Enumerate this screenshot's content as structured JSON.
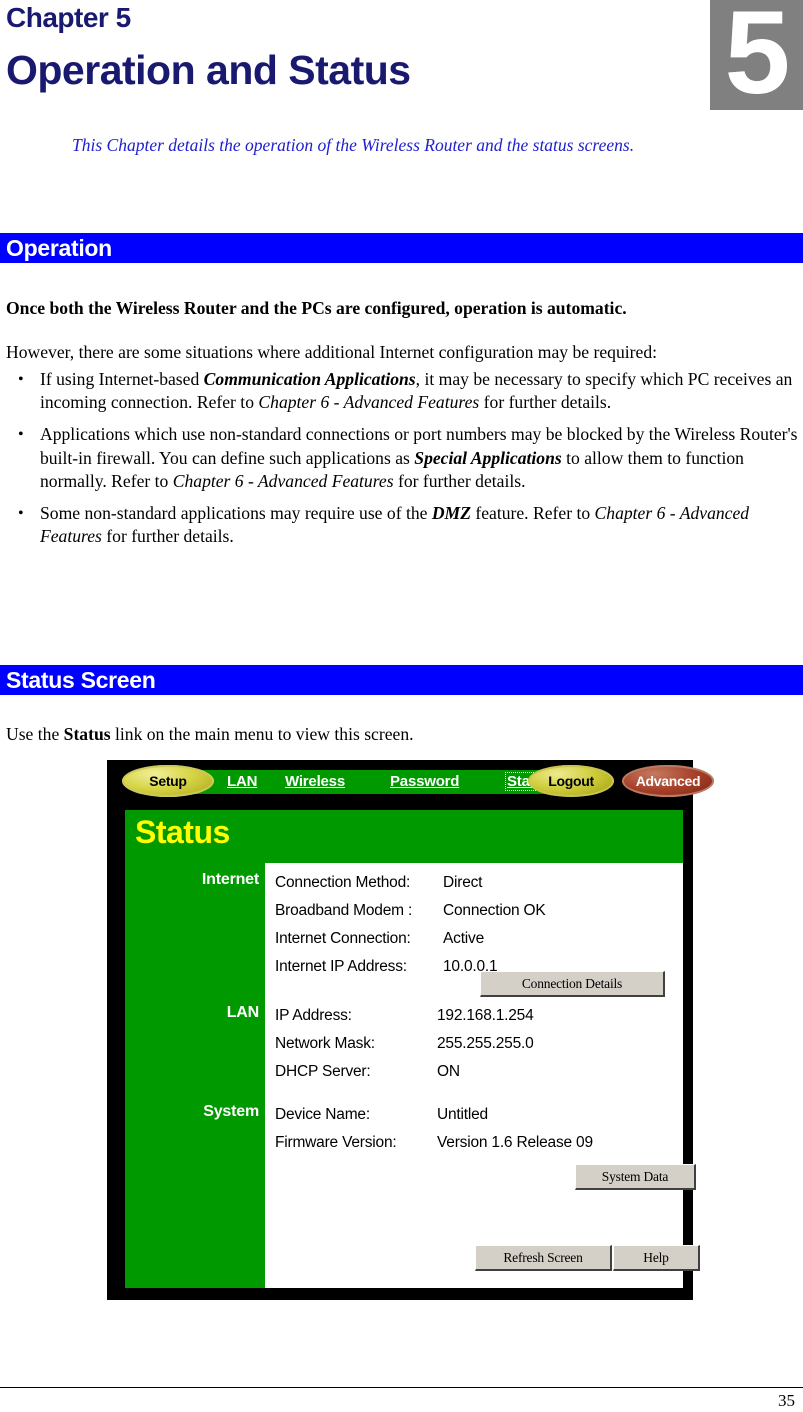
{
  "chapter": {
    "label": "Chapter 5",
    "number_glyph": "5",
    "title": "Operation and Status",
    "intro": "This Chapter details the operation of the Wireless Router and the status screens."
  },
  "sections": {
    "operation": {
      "heading": "Operation",
      "lead_bold": "Once both the Wireless Router and the PCs are configured, operation is automatic.",
      "lead_normal": "However, there are some situations where additional Internet configuration may be required:",
      "bullets": [
        {
          "marker": "•",
          "parts": [
            {
              "text": "If using Internet-based ",
              "style": "normal"
            },
            {
              "text": "Communication Applications",
              "style": "bold-italic"
            },
            {
              "text": ", it may be necessary to specify which PC receives an incoming connection. Refer to ",
              "style": "normal"
            },
            {
              "text": "Chapter 6 - Advanced Features",
              "style": "italic"
            },
            {
              "text": " for further details.",
              "style": "normal"
            }
          ]
        },
        {
          "marker": "•",
          "parts": [
            {
              "text": "Applications which use non-standard connections or port numbers may be blocked by the Wireless Router's built-in firewall. You can define such applications as ",
              "style": "normal"
            },
            {
              "text": "Special Applications",
              "style": "bold-italic"
            },
            {
              "text": " to allow them to function normally. Refer to ",
              "style": "normal"
            },
            {
              "text": "Chapter 6 - Advanced Features",
              "style": "italic"
            },
            {
              "text": " for further details.",
              "style": "normal"
            }
          ]
        },
        {
          "marker": "•",
          "parts": [
            {
              "text": "Some non-standard applications may require use of the ",
              "style": "normal"
            },
            {
              "text": "DMZ",
              "style": "bold-italic"
            },
            {
              "text": " feature. Refer to ",
              "style": "normal"
            },
            {
              "text": "Chapter 6 - Advanced Features",
              "style": "italic"
            },
            {
              "text": " for further details.",
              "style": "normal"
            }
          ]
        }
      ]
    },
    "status_screen": {
      "heading": "Status Screen",
      "intro_parts": [
        {
          "text": "Use the ",
          "style": "normal"
        },
        {
          "text": "Status",
          "style": "bold-italic"
        },
        {
          "text": " link on the main menu to view this screen.",
          "style": "normal"
        }
      ]
    }
  },
  "router_ui": {
    "nav": {
      "setup_label": "Setup",
      "links": [
        "LAN",
        "Wireless",
        "Password",
        "Status"
      ],
      "lan_label": "LAN",
      "wireless_label": "Wireless",
      "password_label": "Password",
      "status_label": "Status",
      "logout_label": "Logout",
      "advanced_label": "Advanced"
    },
    "page_title": "Status",
    "groups": [
      {
        "label": "Internet",
        "rows": [
          {
            "key": "Connection Method:",
            "value": "Direct"
          },
          {
            "key": "Broadband Modem :",
            "value": "Connection OK"
          },
          {
            "key": "Internet Connection:",
            "value": "Active"
          },
          {
            "key": "Internet IP Address:",
            "value": "10.0.0.1"
          }
        ]
      },
      {
        "label": "LAN",
        "rows": [
          {
            "key": "IP Address:",
            "value": "192.168.1.254"
          },
          {
            "key": "Network Mask:",
            "value": "255.255.255.0"
          },
          {
            "key": "DHCP Server:",
            "value": "ON"
          }
        ]
      },
      {
        "label": "System",
        "rows": [
          {
            "key": "Device Name:",
            "value": "Untitled"
          },
          {
            "key": "Firmware Version:",
            "value": "Version 1.6 Release 09"
          }
        ]
      }
    ],
    "buttons": {
      "connection_details": "Connection Details",
      "system_data": "System Data",
      "refresh_screen": "Refresh Screen",
      "help": "Help"
    },
    "colors": {
      "green": "#009900",
      "title_yellow": "#ffff00",
      "frame_black": "#000000",
      "button_face": "#d4d0c8",
      "advanced_red": "#a8402a",
      "pill_yellow": "#cfcd3c"
    }
  },
  "footer": {
    "page_number": "35"
  },
  "theme": {
    "heading_blue": "#0000ff",
    "chapter_navy": "#191970",
    "intro_blue": "#2020d0",
    "number_box_gray": "#808080"
  }
}
